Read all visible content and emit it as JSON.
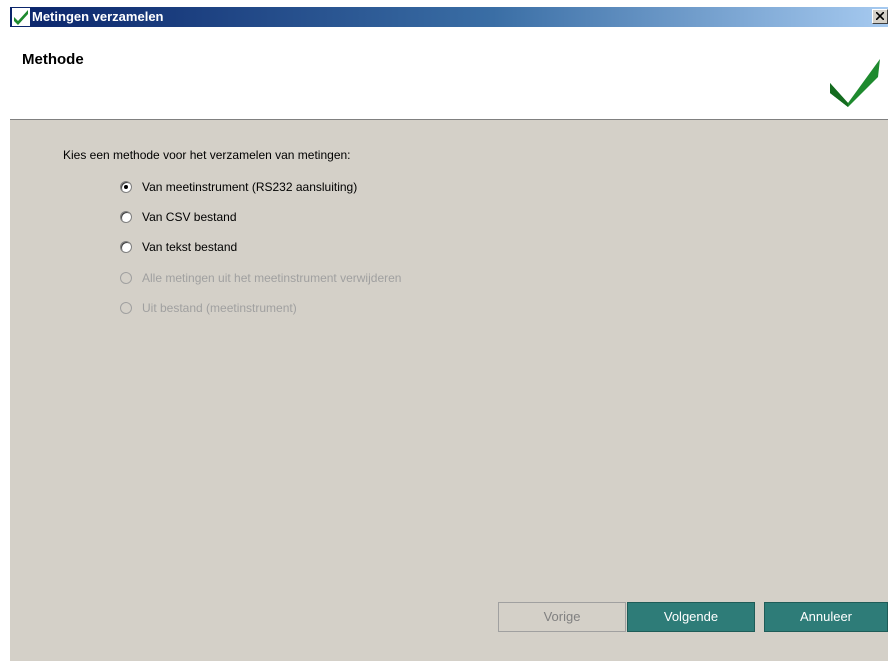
{
  "window": {
    "title": "Metingen verzamelen",
    "close_label": "X"
  },
  "header": {
    "title": "Methode"
  },
  "content": {
    "prompt": "Kies een methode voor het verzamelen van metingen:",
    "options": [
      {
        "label": "Van meetinstrument (RS232 aansluiting)",
        "checked": true,
        "enabled": true
      },
      {
        "label": "Van CSV bestand",
        "checked": false,
        "enabled": true
      },
      {
        "label": "Van  tekst bestand",
        "checked": false,
        "enabled": true
      },
      {
        "label": "Alle metingen uit het meetinstrument verwijderen",
        "checked": false,
        "enabled": false
      },
      {
        "label": "Uit bestand (meetinstrument)",
        "checked": false,
        "enabled": false
      }
    ]
  },
  "buttons": {
    "previous": "Vorige",
    "next": "Volgende",
    "cancel": "Annuleer"
  },
  "colors": {
    "brand_green": "#1e8a2e",
    "button_teal": "#2e7c78",
    "title_bar": "#0a246a",
    "dialog_bg": "#d4d0c8"
  },
  "icons": {
    "title": "checkmark-icon",
    "header": "checkmark-icon",
    "close": "close-icon"
  }
}
